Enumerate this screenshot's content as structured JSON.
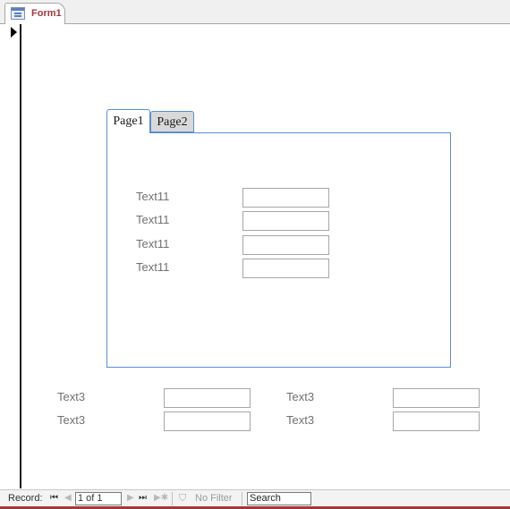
{
  "document_tab": {
    "title": "Form1",
    "icon": "form-icon"
  },
  "record_selector": {
    "icon": "current-record-arrow-icon"
  },
  "tab_control": {
    "pages": [
      {
        "label": "Page1",
        "active": true
      },
      {
        "label": "Page2",
        "active": false
      }
    ],
    "fields": [
      {
        "label": "Text11",
        "value": ""
      },
      {
        "label": "Text11",
        "value": ""
      },
      {
        "label": "Text11",
        "value": ""
      },
      {
        "label": "Text11",
        "value": ""
      }
    ]
  },
  "footer_fields": [
    {
      "label": "Text3",
      "value": ""
    },
    {
      "label": "Text3",
      "value": ""
    },
    {
      "label": "Text3",
      "value": ""
    },
    {
      "label": "Text3",
      "value": ""
    }
  ],
  "nav_bar": {
    "record_label": "Record:",
    "current_record": "1 of 1",
    "first_icon": "⏮",
    "prev_icon": "◀",
    "next_icon": "▶",
    "last_icon": "⏭",
    "new_icon": "▶✱",
    "filter_icon": "⛉",
    "filter_label": "No Filter",
    "search_value": "Search"
  },
  "colors": {
    "accent": "#a4373a",
    "tab_border": "#5a8fd0",
    "label_text": "#707070"
  }
}
